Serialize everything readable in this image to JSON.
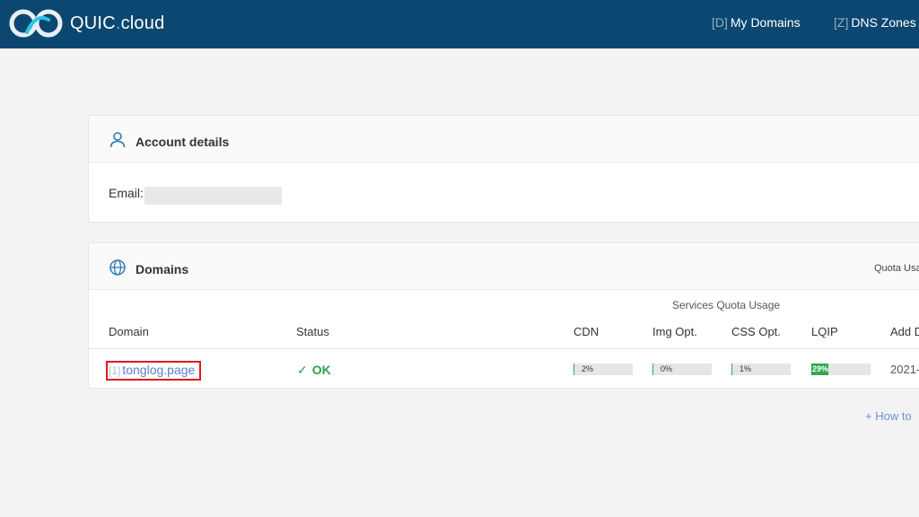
{
  "header": {
    "brand_main": "QUIC",
    "brand_dot": ".",
    "brand_suffix": "cloud",
    "nav": [
      {
        "key": "[D]",
        "label": "My Domains"
      },
      {
        "key": "[Z]",
        "label": "DNS Zones"
      }
    ],
    "colors": {
      "bar": "#0b4770",
      "accent": "#2fc4e8"
    }
  },
  "account": {
    "title": "Account details",
    "icon": "user-icon",
    "email_label": "Email:"
  },
  "domains": {
    "title": "Domains",
    "icon": "globe-icon",
    "quota_label": "Quota Usa",
    "group_label": "Services Quota Usage",
    "columns": {
      "domain": "Domain",
      "status": "Status",
      "cdn": "CDN",
      "img": "Img Opt.",
      "css": "CSS Opt.",
      "lqip": "LQIP",
      "added": "Add D"
    },
    "rows": [
      {
        "index": "[1]",
        "domain": "tonglog.page",
        "status": "OK",
        "cdn": {
          "text": "2%",
          "value": 0.02
        },
        "img": {
          "text": "0%",
          "value": 0
        },
        "css": {
          "text": "1%",
          "value": 0.01
        },
        "lqip": {
          "text": "29%",
          "value": 0.29
        },
        "added": "2021-"
      }
    ]
  },
  "footer": {
    "howto": "How to"
  }
}
